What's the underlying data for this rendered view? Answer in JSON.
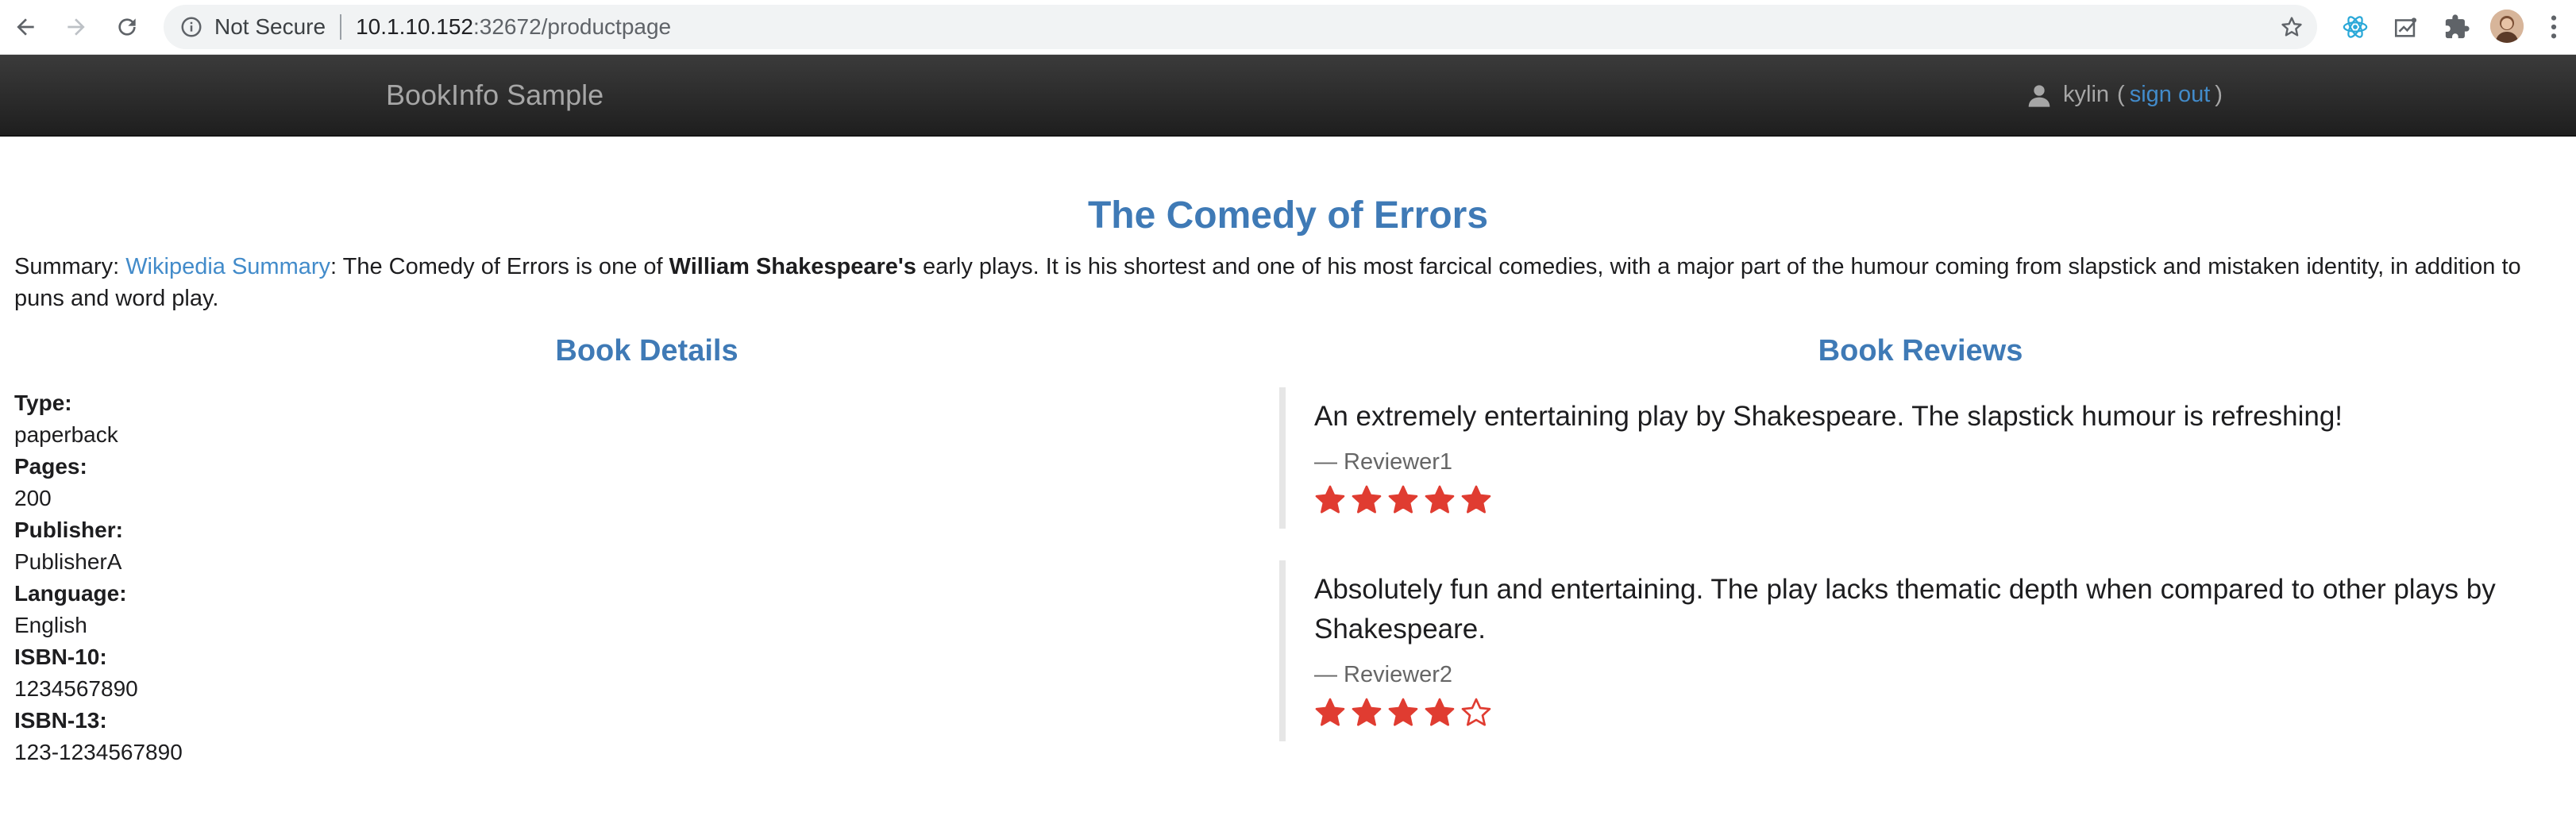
{
  "browser": {
    "security_label": "Not Secure",
    "url_host": "10.1.10.152",
    "url_rest": ":32672/productpage"
  },
  "navbar": {
    "brand": "BookInfo Sample",
    "user": "kylin",
    "open_paren": "(",
    "sign_out": "sign out",
    "close_paren": ")"
  },
  "book": {
    "title": "The Comedy of Errors",
    "summary_prefix": "Summary: ",
    "summary_link": "Wikipedia Summary",
    "summary_mid": ": The Comedy of Errors is one of ",
    "summary_bold": "William Shakespeare's",
    "summary_rest": " early plays. It is his shortest and one of his most farcical comedies, with a major part of the humour coming from slapstick and mistaken identity, in addition to puns and word play."
  },
  "details": {
    "heading": "Book Details",
    "items": [
      {
        "label": "Type:",
        "value": "paperback"
      },
      {
        "label": "Pages:",
        "value": "200"
      },
      {
        "label": "Publisher:",
        "value": "PublisherA"
      },
      {
        "label": "Language:",
        "value": "English"
      },
      {
        "label": "ISBN-10:",
        "value": "1234567890"
      },
      {
        "label": "ISBN-13:",
        "value": "123-1234567890"
      }
    ]
  },
  "reviews": {
    "heading": "Book Reviews",
    "items": [
      {
        "text": "An extremely entertaining play by Shakespeare. The slapstick humour is refreshing!",
        "reviewer": "— Reviewer1",
        "rating": 5,
        "max_rating": 5
      },
      {
        "text": "Absolutely fun and entertaining. The play lacks thematic depth when compared to other plays by Shakespeare.",
        "reviewer": "— Reviewer2",
        "rating": 4,
        "max_rating": 5
      }
    ]
  },
  "colors": {
    "accent": "#3f7ab6",
    "link": "#428bca",
    "star": "#e03c31"
  },
  "icons": {
    "back": "arrow-left-icon",
    "forward": "arrow-right-icon",
    "reload": "reload-icon",
    "info": "info-icon",
    "bookmark": "star-icon",
    "user": "user-icon"
  }
}
